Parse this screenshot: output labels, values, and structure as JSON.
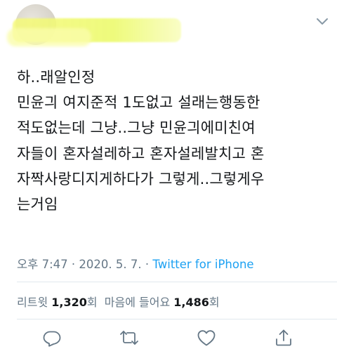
{
  "tweet": {
    "lines": [
      "하..래알인정",
      "민윤긔 여지준적 1도없고 설래는행동한",
      "적도없는데 그냥..그냥 민윤긔에미친여",
      "자들이 혼자설레하고 혼자설레발치고 혼",
      "자짝사랑디지게하다가 그렇게..그렇게우",
      "는거임"
    ]
  },
  "meta": {
    "time": "오후 7:47",
    "sep": " · ",
    "date": "2020. 5. 7.",
    "source": "Twitter for iPhone"
  },
  "stats": {
    "retweet_label": "리트윗 ",
    "retweet_count": "1,320",
    "retweet_unit": "회",
    "like_label": "  마음에 들어요 ",
    "like_count": "1,486",
    "like_unit": "회"
  },
  "icons": {
    "reply": "reply-icon",
    "retweet": "retweet-icon",
    "like": "heart-icon",
    "share": "share-icon",
    "menu": "chevron-down-icon"
  },
  "colors": {
    "link": "#1da1f2",
    "muted": "#657786",
    "text": "#14171a",
    "divider": "#e1e8ed"
  }
}
